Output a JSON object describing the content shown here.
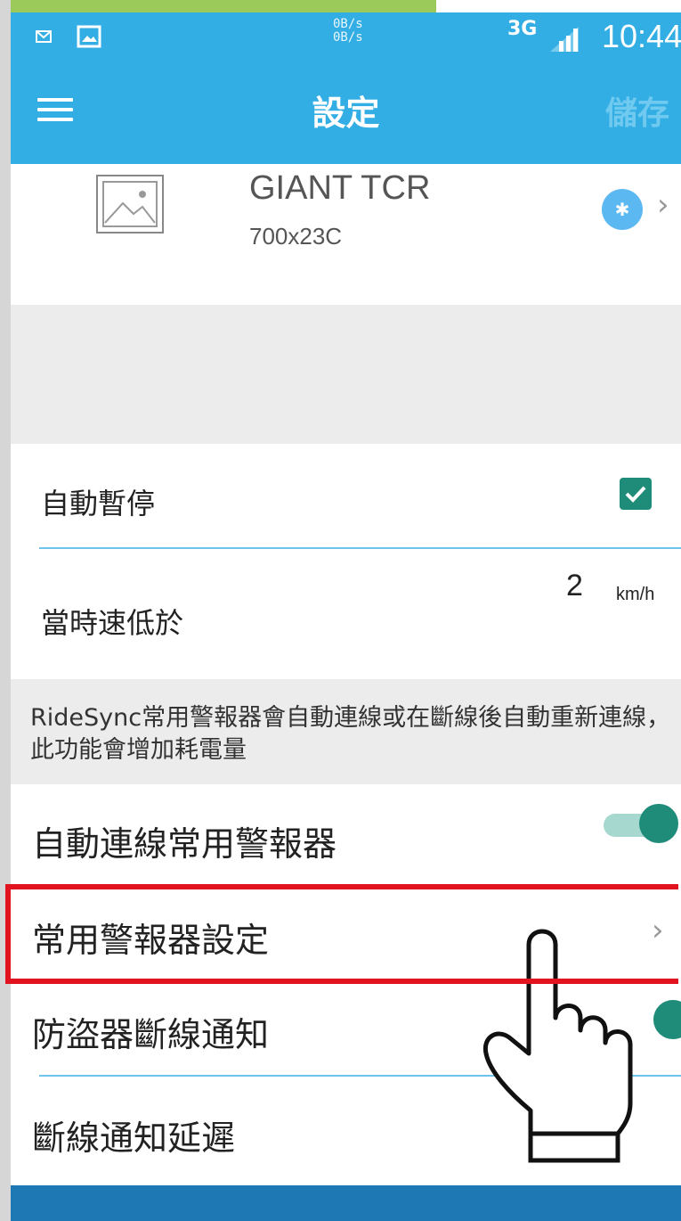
{
  "status_bar": {
    "speed_up": "0B/s",
    "speed_down": "0B/s",
    "network": "3G",
    "time": "10:44"
  },
  "app_bar": {
    "menu_icon": "hamburger-menu-icon",
    "title": "設定",
    "save_label": "儲存"
  },
  "device": {
    "image_icon": "image-placeholder-icon",
    "name": "GIANT TCR",
    "tire": "700x23C",
    "status_icon": "bluetooth-icon"
  },
  "settings": {
    "auto_pause": {
      "label": "自動暫停",
      "checked": true
    },
    "speed_below": {
      "label": "當時速低於",
      "value": "2",
      "unit": "km/h"
    },
    "note": "RideSync常用警報器會自動連線或在斷線後自動重新連線，此功能會增加耗電量",
    "auto_connect": {
      "label": "自動連線常用警報器",
      "enabled": true
    },
    "alarm_settings": {
      "label": "常用警報器設定"
    },
    "disconnect_notify": {
      "label": "防盜器斷線通知"
    },
    "disconnect_delay": {
      "label": "斷線通知延遲"
    }
  },
  "colors": {
    "accent": "#33aee5",
    "toggle_on": "#1f8c79",
    "highlight": "#e0131e"
  }
}
